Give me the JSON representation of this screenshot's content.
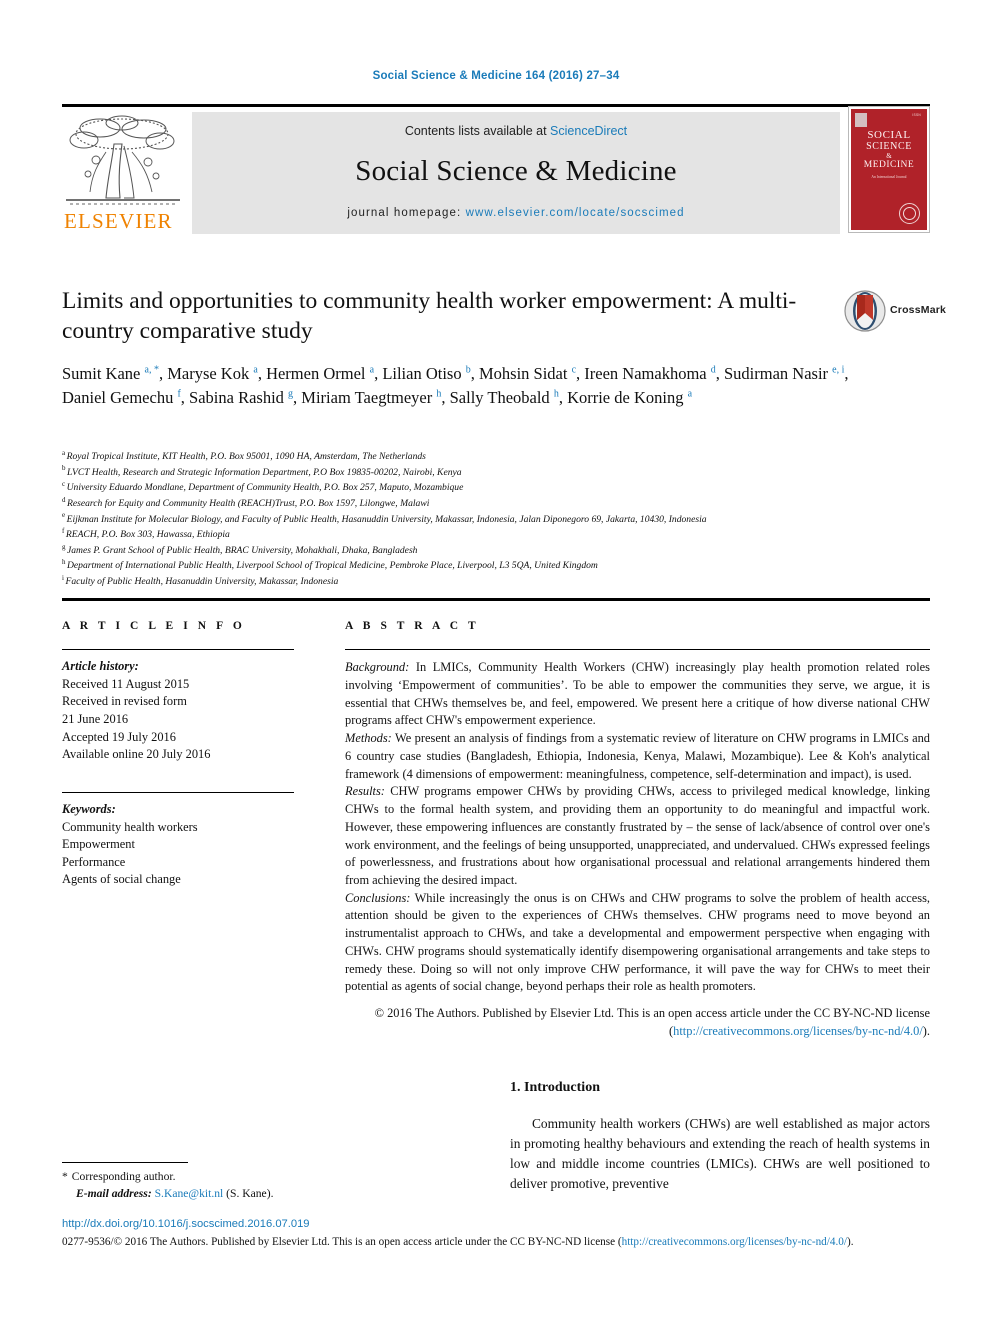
{
  "running_head": "Social Science & Medicine 164 (2016) 27–34",
  "banner": {
    "contents_prefix": "Contents lists available at ",
    "contents_link": "ScienceDirect",
    "journal_name": "Social Science & Medicine",
    "homepage_prefix": "journal homepage: ",
    "homepage_url": "www.elsevier.com/locate/socscimed",
    "publisher": "ELSEVIER",
    "cover": {
      "line1": "SOCIAL",
      "line2": "SCIENCE",
      "amp": "&",
      "line3": "MEDICINE",
      "subtitle": "An International Journal",
      "corner_label": "ISSN"
    }
  },
  "article": {
    "title": "Limits and opportunities to community health worker empowerment: A multi-country comparative study",
    "crossmark_label": "CrossMark"
  },
  "authors": [
    {
      "name": "Sumit Kane",
      "marks": "a, *",
      "sep": ", "
    },
    {
      "name": "Maryse Kok",
      "marks": "a",
      "sep": ", "
    },
    {
      "name": "Hermen Ormel",
      "marks": "a",
      "sep": ", "
    },
    {
      "name": "Lilian Otiso",
      "marks": "b",
      "sep": ", "
    },
    {
      "name": "Mohsin Sidat",
      "marks": "c",
      "sep": ", "
    },
    {
      "name": "Ireen Namakhoma",
      "marks": "d",
      "sep": ", "
    },
    {
      "name": "Sudirman Nasir",
      "marks": "e, i",
      "sep": ", "
    },
    {
      "name": "Daniel Gemechu",
      "marks": "f",
      "sep": ", "
    },
    {
      "name": "Sabina Rashid",
      "marks": "g",
      "sep": ", "
    },
    {
      "name": "Miriam Taegtmeyer",
      "marks": "h",
      "sep": ", "
    },
    {
      "name": "Sally Theobald",
      "marks": "h",
      "sep": ", "
    },
    {
      "name": "Korrie de Koning",
      "marks": "a",
      "sep": ""
    }
  ],
  "affiliations": [
    {
      "mark": "a",
      "text": "Royal Tropical Institute, KIT Health, P.O. Box 95001, 1090 HA, Amsterdam, The Netherlands"
    },
    {
      "mark": "b",
      "text": "LVCT Health, Research and Strategic Information Department, P.O Box 19835-00202, Nairobi, Kenya"
    },
    {
      "mark": "c",
      "text": "University Eduardo Mondlane, Department of Community Health, P.O. Box 257, Maputo, Mozambique"
    },
    {
      "mark": "d",
      "text": "Research for Equity and Community Health (REACH)Trust, P.O. Box 1597, Lilongwe, Malawi"
    },
    {
      "mark": "e",
      "text": "Eijkman Institute for Molecular Biology, and Faculty of Public Health, Hasanuddin University, Makassar, Indonesia, Jalan Diponegoro 69, Jakarta, 10430, Indonesia"
    },
    {
      "mark": "f",
      "text": "REACH, P.O. Box 303, Hawassa, Ethiopia"
    },
    {
      "mark": "g",
      "text": "James P. Grant School of Public Health, BRAC University, Mohakhali, Dhaka, Bangladesh"
    },
    {
      "mark": "h",
      "text": "Department of International Public Health, Liverpool School of Tropical Medicine, Pembroke Place, Liverpool, L3 5QA, United Kingdom"
    },
    {
      "mark": "i",
      "text": "Faculty of Public Health, Hasanuddin University, Makassar, Indonesia"
    }
  ],
  "article_info": {
    "heading": "A R T I C L E  I N F O",
    "history_label": "Article history:",
    "history": [
      "Received 11 August 2015",
      "Received in revised form",
      "21 June 2016",
      "Accepted 19 July 2016",
      "Available online 20 July 2016"
    ],
    "keywords_label": "Keywords:",
    "keywords": [
      "Community health workers",
      "Empowerment",
      "Performance",
      "Agents of social change"
    ]
  },
  "abstract": {
    "heading": "A B S T R A C T",
    "sections": [
      {
        "label": "Background:",
        "text": " In LMICs, Community Health Workers (CHW) increasingly play health promotion related roles involving ‘Empowerment of communities’. To be able to empower the communities they serve, we argue, it is essential that CHWs themselves be, and feel, empowered. We present here a critique of how diverse national CHW programs affect CHW's empowerment experience."
      },
      {
        "label": "Methods:",
        "text": " We present an analysis of findings from a systematic review of literature on CHW programs in LMICs and 6 country case studies (Bangladesh, Ethiopia, Indonesia, Kenya, Malawi, Mozambique). Lee & Koh's analytical framework (4 dimensions of empowerment: meaningfulness, competence, self-determination and impact), is used."
      },
      {
        "label": "Results:",
        "text": " CHW programs empower CHWs by providing CHWs, access to privileged medical knowledge, linking CHWs to the formal health system, and providing them an opportunity to do meaningful and impactful work. However, these empowering influences are constantly frustrated by – the sense of lack/absence of control over one's work environment, and the feelings of being unsupported, unappreciated, and undervalued. CHWs expressed feelings of powerlessness, and frustrations about how organisational processual and relational arrangements hindered them from achieving the desired impact."
      },
      {
        "label": "Conclusions:",
        "text": " While increasingly the onus is on CHWs and CHW programs to solve the problem of health access, attention should be given to the experiences of CHWs themselves. CHW programs need to move beyond an instrumentalist approach to CHWs, and take a developmental and empowerment perspective when engaging with CHWs. CHW programs should systematically identify disempowering organisational arrangements and take steps to remedy these. Doing so will not only improve CHW performance, it will pave the way for CHWs to meet their potential as agents of social change, beyond perhaps their role as health promoters."
      }
    ],
    "copyright_text": "© 2016 The Authors. Published by Elsevier Ltd. This is an open access article under the CC BY-NC-ND license (",
    "copyright_link": "http://creativecommons.org/licenses/by-nc-nd/4.0/",
    "copyright_tail": ")."
  },
  "introduction": {
    "heading": "1. Introduction",
    "paragraph": "Community health workers (CHWs) are well established as major actors in promoting healthy behaviours and extending the reach of health systems in low and middle income countries (LMICs). CHWs are well positioned to deliver promotive, preventive"
  },
  "footnote": {
    "corresponding": "Corresponding author.",
    "email_label": "E-mail address:",
    "email": "S.Kane@kit.nl",
    "email_owner": "(S. Kane)."
  },
  "bottom": {
    "doi": "http://dx.doi.org/10.1016/j.socscimed.2016.07.019",
    "issn_prefix": "0277-9536/© 2016 The Authors. Published by Elsevier Ltd. This is an open access article under the CC BY-NC-ND license (",
    "issn_link": "http://creativecommons.org/licenses/by-nc-nd/4.0/",
    "issn_tail": ")."
  },
  "colors": {
    "link": "#1a7bb9",
    "elsevier_orange": "#ef8200",
    "cover_red": "#b02229",
    "banner_bg": "#e4e4e4"
  }
}
